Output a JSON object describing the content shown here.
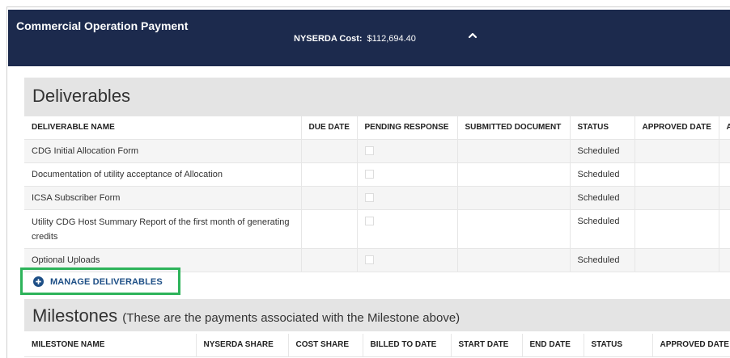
{
  "header": {
    "title": "Commercial Operation Payment",
    "cost_label": "NYSERDA Cost:",
    "cost_value": "$112,694.40"
  },
  "deliverables": {
    "heading": "Deliverables",
    "columns": [
      "DELIVERABLE NAME",
      "DUE DATE",
      "PENDING RESPONSE",
      "SUBMITTED DOCUMENT",
      "STATUS",
      "APPROVED DATE",
      "A"
    ],
    "rows": [
      {
        "name": "CDG Initial Allocation Form",
        "due_date": "",
        "pending": false,
        "submitted": "",
        "status": "Scheduled",
        "approved": ""
      },
      {
        "name": "Documentation of utility acceptance of Allocation",
        "due_date": "",
        "pending": false,
        "submitted": "",
        "status": "Scheduled",
        "approved": ""
      },
      {
        "name": "ICSA Subscriber Form",
        "due_date": "",
        "pending": false,
        "submitted": "",
        "status": "Scheduled",
        "approved": ""
      },
      {
        "name": "Utility CDG Host Summary Report of the first month of generating credits",
        "due_date": "",
        "pending": false,
        "submitted": "",
        "status": "Scheduled",
        "approved": ""
      },
      {
        "name": "Optional Uploads",
        "due_date": "",
        "pending": false,
        "submitted": "",
        "status": "Scheduled",
        "approved": ""
      }
    ],
    "manage_label": "MANAGE DELIVERABLES"
  },
  "milestones": {
    "heading": "Milestones",
    "subheading": "(These are the payments associated with the Milestone above)",
    "columns": [
      "MILESTONE NAME",
      "NYSERDA SHARE",
      "COST SHARE",
      "BILLED TO DATE",
      "START DATE",
      "END DATE",
      "STATUS",
      "APPROVED DATE"
    ]
  },
  "colors": {
    "header_bg": "#1c2a4d",
    "highlight_border": "#2db35a",
    "link": "#1e4f86"
  },
  "icons": {
    "caret": "chevron-up-icon",
    "manage": "plus-circle-icon"
  }
}
